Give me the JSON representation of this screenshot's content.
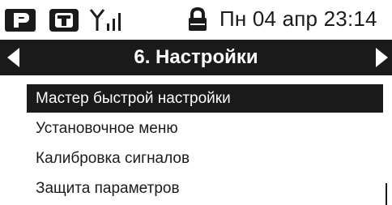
{
  "status_bar": {
    "icons": [
      "parking-p-icon",
      "terminal-t-icon",
      "antenna-signal-icon",
      "lock-icon"
    ],
    "datetime": "Пн 04 апр 23:14"
  },
  "title_bar": {
    "title": "6. Настройки",
    "prev_icon": "left-arrow-icon",
    "next_icon": "right-arrow-icon"
  },
  "menu": {
    "items": [
      {
        "label": "Мастер быстрой настройки",
        "selected": true
      },
      {
        "label": "Установочное меню",
        "selected": false
      },
      {
        "label": "Калибровка сигналов",
        "selected": false
      },
      {
        "label": "Защита параметров",
        "selected": false
      }
    ]
  },
  "colors": {
    "foreground": "#1a1a1a",
    "background": "#ffffff",
    "selected_text": "#ffffff"
  }
}
